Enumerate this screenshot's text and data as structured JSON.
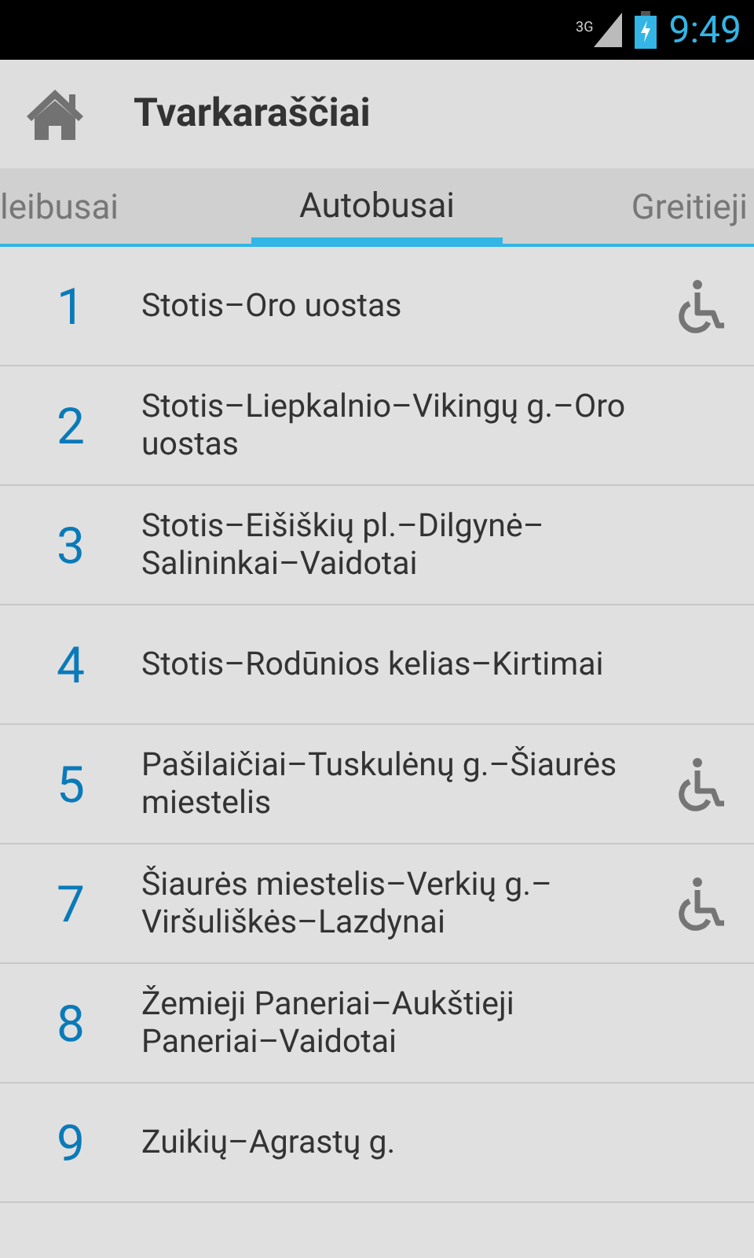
{
  "status_bar": {
    "network": "3G",
    "time": "9:49"
  },
  "action_bar": {
    "title": "Tvarkaraščiai"
  },
  "tabs": [
    {
      "label": "leibusai",
      "selected": false
    },
    {
      "label": "Autobusai",
      "selected": true
    },
    {
      "label": "Greitieji",
      "selected": false
    }
  ],
  "routes": [
    {
      "number": "1",
      "name": "Stotis–Oro uostas",
      "accessible": true
    },
    {
      "number": "2",
      "name": "Stotis–Liepkalnio–Vikingų g.–Oro uostas",
      "accessible": false
    },
    {
      "number": "3",
      "name": "Stotis–Eišiškių pl.–Dilgynė–Salininkai–Vaidotai",
      "accessible": false
    },
    {
      "number": "4",
      "name": "Stotis–Rodūnios kelias–Kirtimai",
      "accessible": false
    },
    {
      "number": "5",
      "name": "Pašilaičiai–Tuskulėnų g.–Šiaurės miestelis",
      "accessible": true
    },
    {
      "number": "7",
      "name": "Šiaurės miestelis–Verkių g.–Viršuliškės–Lazdynai",
      "accessible": true
    },
    {
      "number": "8",
      "name": "Žemieji Paneriai–Aukštieji Paneriai–Vaidotai",
      "accessible": false
    },
    {
      "number": "9",
      "name": "Zuikių–Agrastų g.",
      "accessible": false
    }
  ]
}
